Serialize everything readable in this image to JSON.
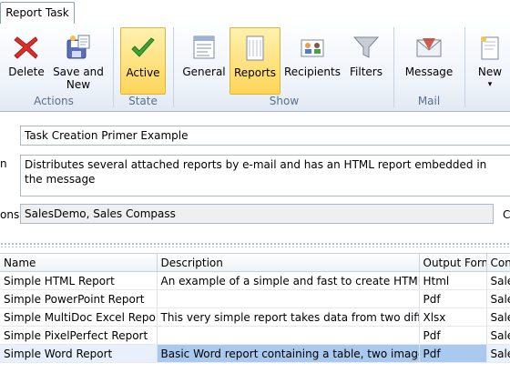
{
  "tabs": [
    {
      "label": "Report Task"
    }
  ],
  "ribbon": {
    "groups": {
      "actions": "Actions",
      "state": "State",
      "show": "Show",
      "mail": "Mail"
    },
    "buttons": {
      "delete": "Delete",
      "save_and_new_1": "Save and",
      "save_and_new_2": "New",
      "active": "Active",
      "general": "General",
      "reports": "Reports",
      "recipients": "Recipients",
      "filters": "Filters",
      "message": "Message",
      "new": "New",
      "new_arrow": "▾"
    },
    "icons": {
      "delete": "red-x-icon",
      "save_and_new": "save-new-icon",
      "active": "checkmark-icon",
      "general": "general-icon",
      "reports": "reports-icon",
      "recipients": "recipients-icon",
      "filters": "funnel-icon",
      "message": "envelope-icon",
      "new": "new-document-icon"
    },
    "colors": {
      "active_bg": "#ffd558",
      "delete_red": "#d9302b",
      "check_green": "#3aa534"
    }
  },
  "form": {
    "task_name": "Task Creation Primer Example",
    "description_label_partial": "n",
    "description": "Distributes several attached reports by e-mail and has an HTML report embedded in the message",
    "connections_label_partial": "ons",
    "connections": "SalesDemo, Sales Compass",
    "right_cut_label": "C"
  },
  "grid": {
    "columns": [
      "Name",
      "Description",
      "Output Form",
      "Conn"
    ],
    "rows": [
      {
        "name": "Simple HTML Report",
        "description": "An example of a simple and fast to create HTML repor",
        "output": "Html",
        "conn": "Sales"
      },
      {
        "name": "Simple PowerPoint Report",
        "description": "",
        "output": "Pdf",
        "conn": "Sales"
      },
      {
        "name": "Simple MultiDoc Excel Report",
        "description": "This very simple report takes data from two different C",
        "output": "Xlsx",
        "conn": "Sales"
      },
      {
        "name": "Simple PixelPerfect Report",
        "description": "",
        "output": "Pdf",
        "conn": "Sales"
      },
      {
        "name": "Simple Word Report",
        "description": "Basic Word report containing a table, two images, and",
        "output": "Pdf",
        "conn": "Sales"
      }
    ],
    "selected_row": "Simple Word Report"
  }
}
